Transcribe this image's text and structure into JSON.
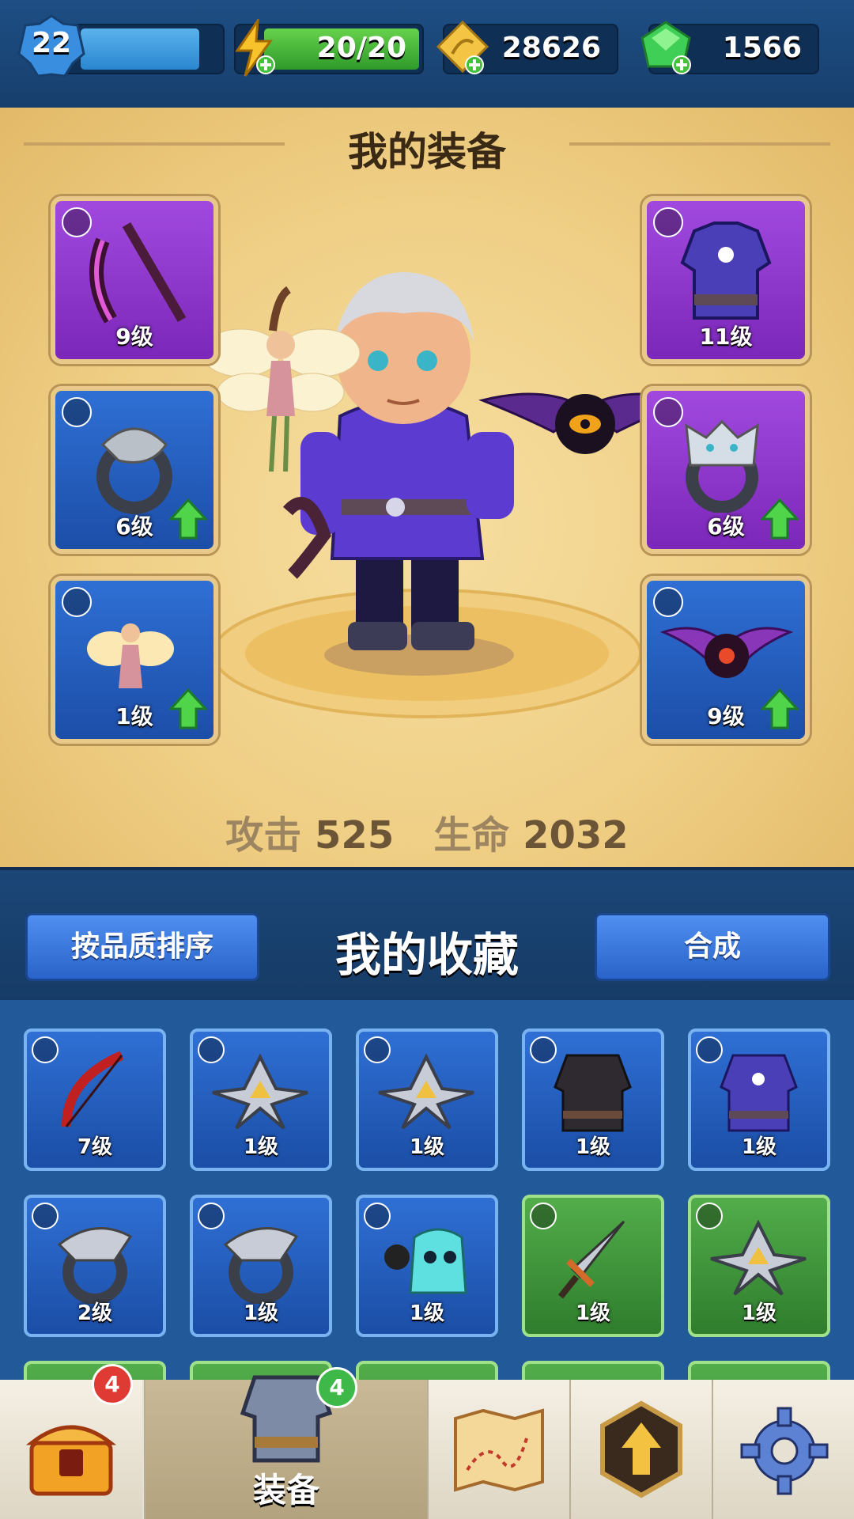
{
  "topbar": {
    "level": "22",
    "energy": "20/20",
    "gold": "28626",
    "gems": "1566"
  },
  "equipment": {
    "title": "我的装备",
    "slots": [
      {
        "level": "9级",
        "rarity": "purple",
        "item": "bow-icon"
      },
      {
        "level": "6级",
        "rarity": "blue",
        "item": "snake-ring-icon"
      },
      {
        "level": "1级",
        "rarity": "blue",
        "item": "fairy-pet-icon"
      },
      {
        "level": "11级",
        "rarity": "purple",
        "item": "armor-icon"
      },
      {
        "level": "6级",
        "rarity": "purple",
        "item": "wolf-ring-icon"
      },
      {
        "level": "9级",
        "rarity": "blue",
        "item": "bat-pet-icon"
      }
    ],
    "stats": {
      "attack_label": "攻击",
      "attack": "525",
      "hp_label": "生命",
      "hp": "2032"
    }
  },
  "collection": {
    "sort_button": "按品质排序",
    "title": "我的收藏",
    "merge_button": "合成",
    "items": [
      {
        "level": "7级",
        "rarity": "blue"
      },
      {
        "level": "1级",
        "rarity": "blue"
      },
      {
        "level": "1级",
        "rarity": "blue"
      },
      {
        "level": "1级",
        "rarity": "blue"
      },
      {
        "level": "1级",
        "rarity": "blue"
      },
      {
        "level": "2级",
        "rarity": "blue"
      },
      {
        "level": "1级",
        "rarity": "blue"
      },
      {
        "level": "1级",
        "rarity": "blue"
      },
      {
        "level": "1级",
        "rarity": "green"
      },
      {
        "level": "1级",
        "rarity": "green"
      }
    ]
  },
  "nav": {
    "chest_badge": "4",
    "equip_badge": "4",
    "equip_label": "装备"
  },
  "colors": {
    "purple": "#8a32c9",
    "blue": "#2a62c4",
    "green": "#43983d",
    "gold_bg": "#efcf85"
  }
}
